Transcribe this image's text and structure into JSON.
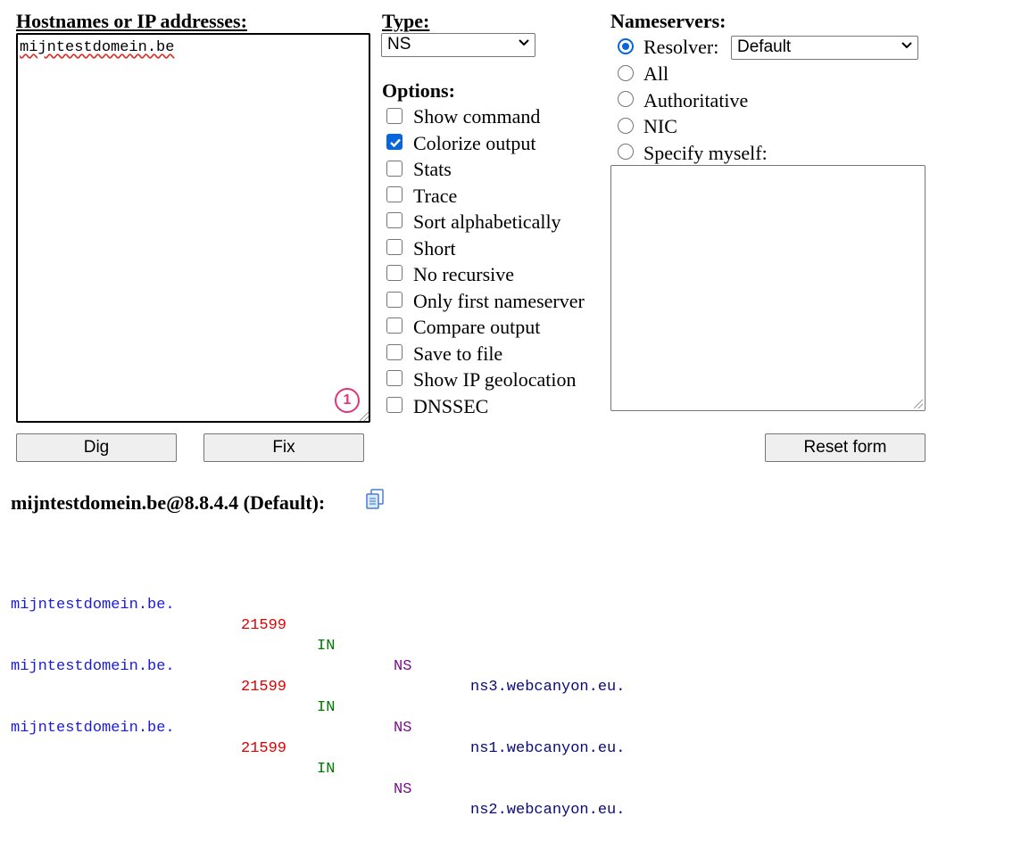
{
  "hostnames": {
    "label": "Hostnames or IP addresses:",
    "value": "mijntestdomein.be",
    "badge": "1"
  },
  "type": {
    "label": "Type:",
    "selected": "NS"
  },
  "options": {
    "label": "Options:",
    "items": [
      {
        "label": "Show command",
        "checked": false
      },
      {
        "label": "Colorize output",
        "checked": true
      },
      {
        "label": "Stats",
        "checked": false
      },
      {
        "label": "Trace",
        "checked": false
      },
      {
        "label": "Sort alphabetically",
        "checked": false
      },
      {
        "label": "Short",
        "checked": false
      },
      {
        "label": "No recursive",
        "checked": false
      },
      {
        "label": "Only first nameserver",
        "checked": false
      },
      {
        "label": "Compare output",
        "checked": false
      },
      {
        "label": "Save to file",
        "checked": false
      },
      {
        "label": "Show IP geolocation",
        "checked": false
      },
      {
        "label": "DNSSEC",
        "checked": false
      }
    ]
  },
  "nameservers": {
    "label": "Nameservers:",
    "resolver_label": "Resolver:",
    "resolver_selected": "Default",
    "radios": [
      {
        "label": "Resolver:",
        "checked": true
      },
      {
        "label": "All",
        "checked": false
      },
      {
        "label": "Authoritative",
        "checked": false
      },
      {
        "label": "NIC",
        "checked": false
      },
      {
        "label": "Specify myself:",
        "checked": false
      }
    ],
    "custom_value": ""
  },
  "buttons": {
    "dig": "Dig",
    "fix": "Fix",
    "reset": "Reset form"
  },
  "result": {
    "heading": "mijntestdomein.be@8.8.4.4 (Default):",
    "copy_icon": "copy-icon",
    "rows": [
      {
        "name": "mijntestdomein.be.",
        "ttl": "21599",
        "class": "IN",
        "type": "NS",
        "data": "ns3.webcanyon.eu."
      },
      {
        "name": "mijntestdomein.be.",
        "ttl": "21599",
        "class": "IN",
        "type": "NS",
        "data": "ns1.webcanyon.eu."
      },
      {
        "name": "mijntestdomein.be.",
        "ttl": "21599",
        "class": "IN",
        "type": "NS",
        "data": "ns2.webcanyon.eu."
      }
    ]
  },
  "colors": {
    "name": "#1a1adb",
    "ttl": "#e00000",
    "class": "#007a00",
    "type": "#7a0e8a",
    "data": "#0a0a7a",
    "accent": "#0a66d8",
    "badge": "#e0367a"
  }
}
